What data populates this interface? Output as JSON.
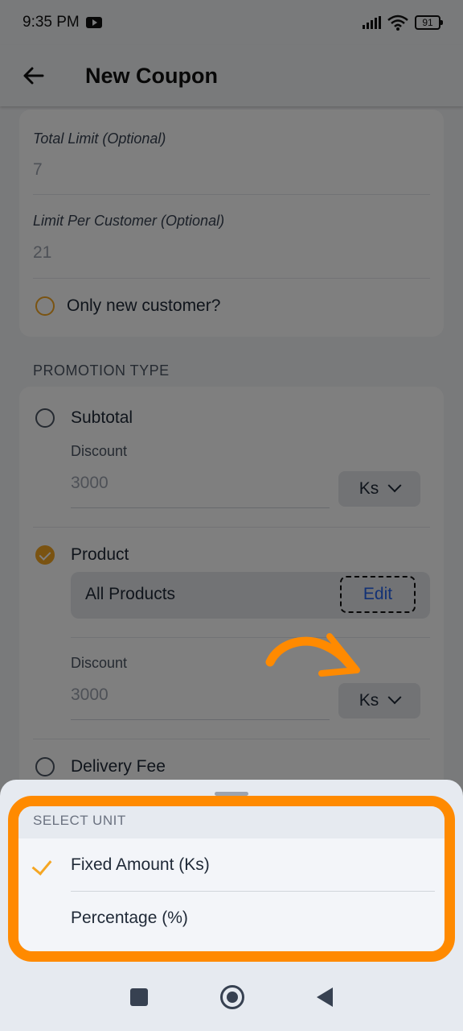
{
  "status_bar": {
    "time": "9:35 PM",
    "battery": "91"
  },
  "header": {
    "title": "New Coupon"
  },
  "limits": {
    "total_limit_label": "Total Limit (Optional)",
    "total_limit_value": "7",
    "per_customer_label": "Limit Per Customer (Optional)",
    "per_customer_value": "21",
    "only_new_label": "Only new customer?"
  },
  "promotion": {
    "section_title": "PROMOTION TYPE",
    "subtotal": {
      "label": "Subtotal",
      "discount_label": "Discount",
      "discount_placeholder": "3000",
      "unit": "Ks"
    },
    "product": {
      "label": "Product",
      "products_label": "All Products",
      "edit_label": "Edit",
      "discount_label": "Discount",
      "discount_placeholder": "3000",
      "unit": "Ks"
    },
    "delivery": {
      "label": "Delivery Fee"
    }
  },
  "sheet": {
    "title": "SELECT UNIT",
    "options": [
      {
        "label": "Fixed Amount (Ks)",
        "selected": true
      },
      {
        "label": "Percentage (%)",
        "selected": false
      }
    ]
  },
  "colors": {
    "accent": "#f5a623",
    "highlight": "#ff8a00",
    "link": "#2563eb"
  }
}
